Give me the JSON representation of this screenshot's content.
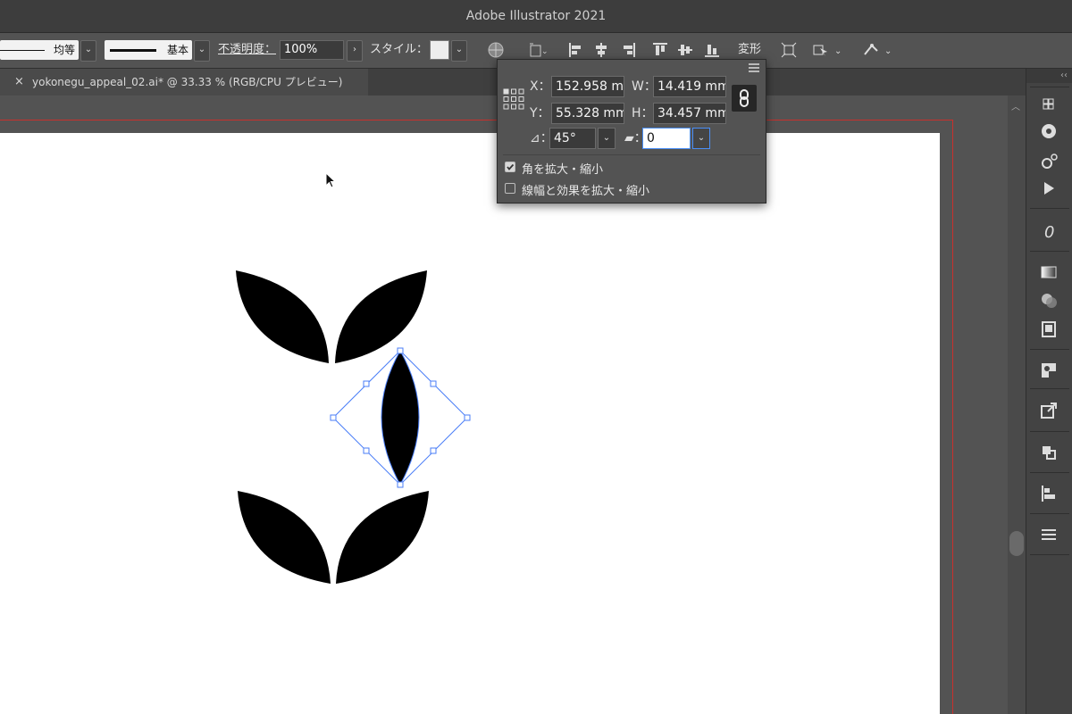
{
  "window": {
    "title": "Adobe Illustrator 2021"
  },
  "controlbar": {
    "stroke_profile_label": "均等",
    "brush_label": "基本",
    "opacity_label": "不透明度：",
    "opacity_value": "100%",
    "style_label": "スタイル：",
    "transform_label": "変形",
    "icons": [
      "recolor-icon",
      "shape-transform-icon",
      "align-left-icon",
      "align-center-icon",
      "align-right-icon",
      "align-top-icon",
      "align-middle-icon",
      "align-bottom-icon",
      "isolate-icon",
      "select-similar-icon",
      "puppet-warp-icon"
    ]
  },
  "tab": {
    "title": "yokonegu_appeal_02.ai* @ 33.33 % (RGB/CPU プレビュー)",
    "close": "×"
  },
  "transform_panel": {
    "x_label": "X：",
    "x_value": "152.958 m",
    "y_label": "Y：",
    "y_value": "55.328 mm",
    "w_label": "W：",
    "w_value": "14.419 mm",
    "h_label": "H：",
    "h_value": "34.457 mm",
    "rotate_label": "⊿：",
    "rotate_value": "45°",
    "shear_label": "▰：",
    "shear_value": "0",
    "scale_corners_label": "角を拡大・縮小",
    "scale_corners_checked": true,
    "scale_strokes_label": "線幅と効果を拡大・縮小",
    "scale_strokes_checked": false
  },
  "dock": {
    "collapse": "‹‹",
    "icons": [
      "libraries-icon",
      "color-wheel-icon",
      "gear-icon",
      "play-icon",
      "glyphs-icon",
      "gradient-icon",
      "transparency-icon",
      "appearance-icon",
      "image-trace-icon",
      "export-icon",
      "pathfinder-icon",
      "align-panel-icon",
      "menu-icon"
    ]
  },
  "colors": {
    "accent": "#4a8ef7",
    "artboard_border": "#c9302c",
    "selection": "#4a7ef7",
    "shape_fill": "#000000"
  }
}
